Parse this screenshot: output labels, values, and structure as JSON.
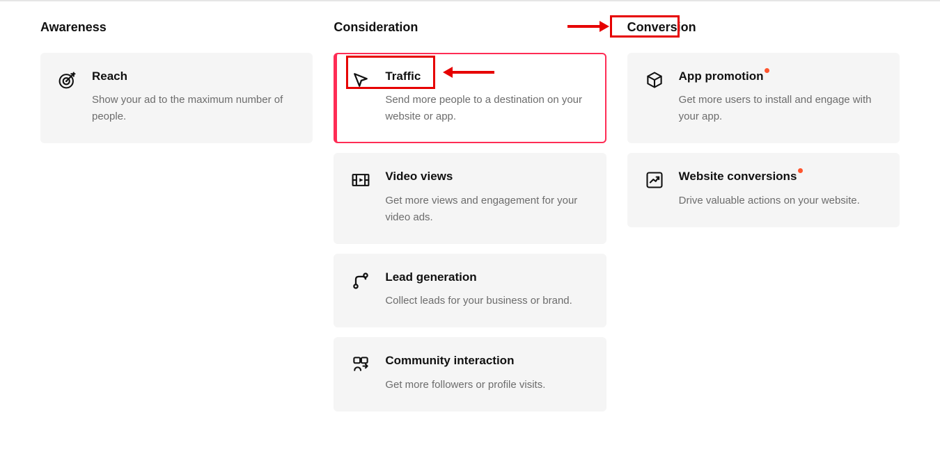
{
  "columns": {
    "awareness": {
      "title": "Awareness",
      "reach": {
        "title": "Reach",
        "desc": "Show your ad to the maximum number of people."
      }
    },
    "consideration": {
      "title": "Consideration",
      "traffic": {
        "title": "Traffic",
        "desc": "Send more people to a destination on your website or app."
      },
      "video": {
        "title": "Video views",
        "desc": "Get more views and engagement for your video ads."
      },
      "lead": {
        "title": "Lead generation",
        "desc": "Collect leads for your business or brand."
      },
      "community": {
        "title": "Community interaction",
        "desc": "Get more followers or profile visits."
      }
    },
    "conversion": {
      "title": "Conversion",
      "app": {
        "title": "App promotion",
        "desc": "Get more users to install and engage with your app."
      },
      "site": {
        "title": "Website conversions",
        "desc": "Drive valuable actions on your website."
      }
    }
  }
}
